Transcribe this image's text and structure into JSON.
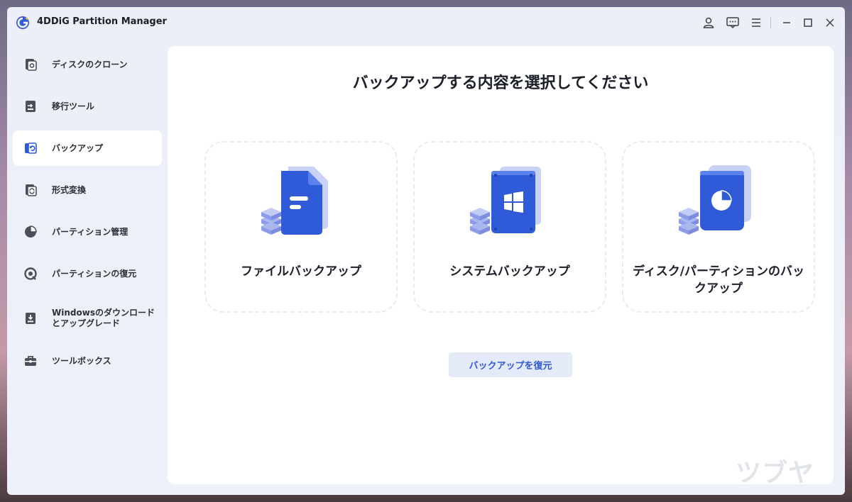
{
  "app": {
    "title": "4DDiG Partition Manager"
  },
  "colors": {
    "accent": "#2f5bd8",
    "sidebar_bg": "#eceef8",
    "main_bg": "#ffffff"
  },
  "titlebar_icons": [
    "account-icon",
    "feedback-icon",
    "menu-icon",
    "minimize-icon",
    "maximize-icon",
    "close-icon"
  ],
  "sidebar": {
    "items": [
      {
        "label": "ディスクのクローン",
        "icon": "disk-clone-icon",
        "active": false
      },
      {
        "label": "移行ツール",
        "icon": "migration-icon",
        "active": false
      },
      {
        "label": "バックアップ",
        "icon": "backup-icon",
        "active": true
      },
      {
        "label": "形式変換",
        "icon": "convert-icon",
        "active": false
      },
      {
        "label": "パーティション管理",
        "icon": "pie-icon",
        "active": false
      },
      {
        "label": "パーティションの復元",
        "icon": "recover-icon",
        "active": false
      },
      {
        "label": "Windowsのダウンロードとアップグレード",
        "icon": "download-icon",
        "active": false
      },
      {
        "label": "ツールボックス",
        "icon": "toolbox-icon",
        "active": false
      }
    ]
  },
  "main": {
    "heading": "バックアップする内容を選択してください",
    "cards": [
      {
        "title": "ファイルバックアップ",
        "icon": "file-backup-icon"
      },
      {
        "title": "システムバックアップ",
        "icon": "system-backup-icon"
      },
      {
        "title": "ディスク/パーティションのバックアップ",
        "icon": "partition-backup-icon"
      }
    ],
    "restore_label": "バックアップを復元"
  },
  "watermark": "ツブヤク。"
}
